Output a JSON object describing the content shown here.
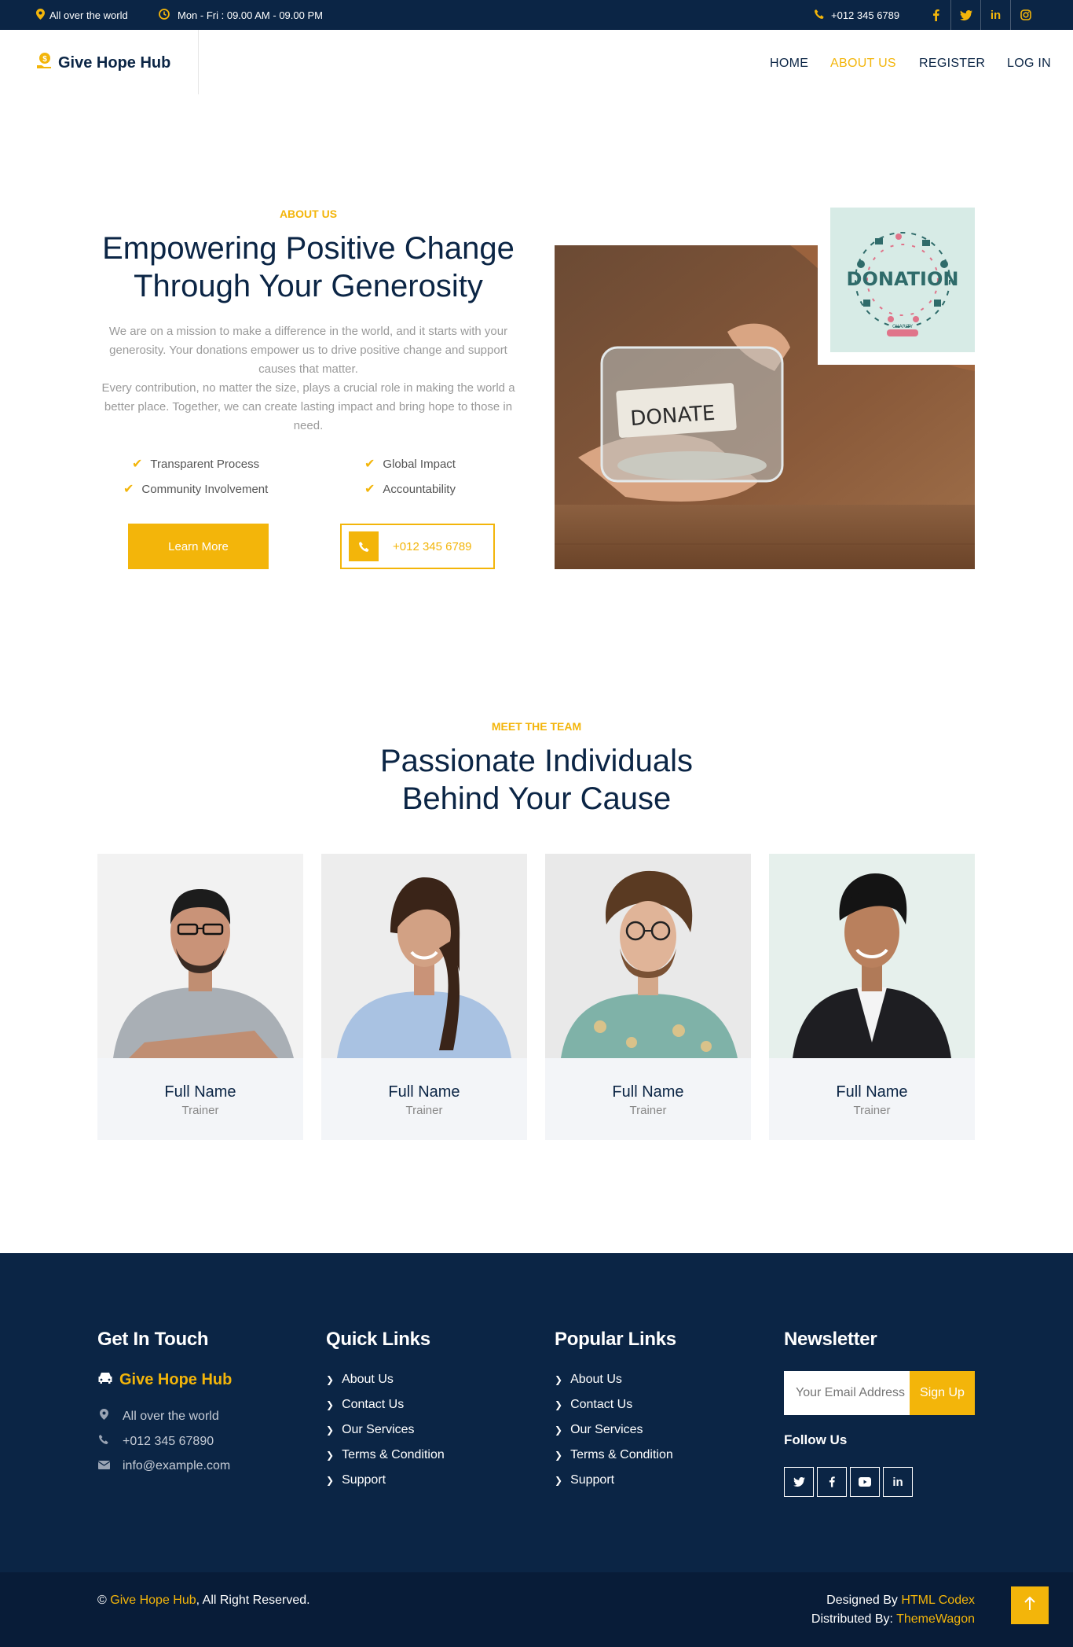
{
  "topbar": {
    "location": "All over the world",
    "hours": "Mon - Fri : 09.00 AM - 09.00 PM",
    "phone": "+012 345 6789",
    "social": [
      "f",
      "t",
      "in",
      "ig"
    ]
  },
  "header": {
    "brand": "Give Hope Hub",
    "nav": [
      {
        "label": "HOME",
        "active": false
      },
      {
        "label": "ABOUT US",
        "active": true
      },
      {
        "label": "REGISTER",
        "active": false
      },
      {
        "label": "LOG IN",
        "active": false
      }
    ]
  },
  "about": {
    "eyebrow": "ABOUT US",
    "title_line1": "Empowering Positive Change",
    "title_line2": "Through Your Generosity",
    "para1": "We are on a mission to make a difference in the world, and it starts with your generosity. Your donations empower us to drive positive change and support causes that matter.",
    "para2": "Every contribution, no matter the size, plays a crucial role in making the world a better place. Together, we can create lasting impact and bring hope to those in need.",
    "checks": [
      "Transparent Process",
      "Global Impact",
      "Community Involvement",
      "Accountability"
    ],
    "learn_more": "Learn More",
    "phone": "+012 345 6789",
    "jar_label": "DONATE",
    "donation_word": "DONATION",
    "donation_small": "CHARITY"
  },
  "team": {
    "eyebrow": "MEET THE TEAM",
    "title_line1": "Passionate Individuals",
    "title_line2": "Behind Your Cause",
    "members": [
      {
        "name": "Full Name",
        "role": "Trainer"
      },
      {
        "name": "Full Name",
        "role": "Trainer"
      },
      {
        "name": "Full Name",
        "role": "Trainer"
      },
      {
        "name": "Full Name",
        "role": "Trainer"
      }
    ]
  },
  "footer": {
    "get_in_touch": "Get In Touch",
    "brand": "Give Hope Hub",
    "address": "All over the world",
    "phone": "+012 345 67890",
    "email": "info@example.com",
    "quick_links_title": "Quick Links",
    "quick_links": [
      "About Us",
      "Contact Us",
      "Our Services",
      "Terms & Condition",
      "Support"
    ],
    "popular_links_title": "Popular Links",
    "popular_links": [
      "About Us",
      "Contact Us",
      "Our Services",
      "Terms & Condition",
      "Support"
    ],
    "newsletter_title": "Newsletter",
    "newsletter_placeholder": "Your Email Address",
    "signup": "Sign Up",
    "follow_us": "Follow Us"
  },
  "copyright": {
    "symbol": "©",
    "brand": "Give Hope Hub",
    "rights": ", All Right Reserved.",
    "designed_by_label": "Designed By",
    "designed_by": "HTML Codex",
    "distributed_by_label": "Distributed By:",
    "distributed_by": "ThemeWagon"
  },
  "colors": {
    "navy": "#0b2545",
    "accent": "#f3b50a",
    "card_bg": "#f3f5f8"
  }
}
